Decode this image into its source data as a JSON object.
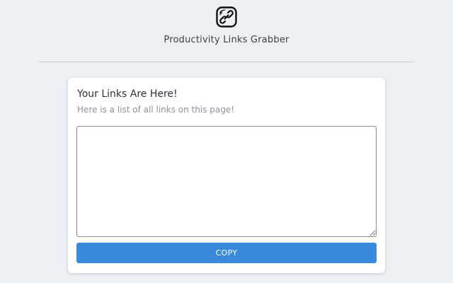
{
  "header": {
    "logo_icon": "chain-link-icon",
    "app_title": "Productivity Links Grabber"
  },
  "card": {
    "title": "Your Links Are Here!",
    "subtitle": "Here is a list of all links on this page!",
    "textarea_value": "",
    "copy_label": "COPY"
  },
  "colors": {
    "background": "#edf1f6",
    "accent": "#3a89dc",
    "card": "#ffffff"
  }
}
